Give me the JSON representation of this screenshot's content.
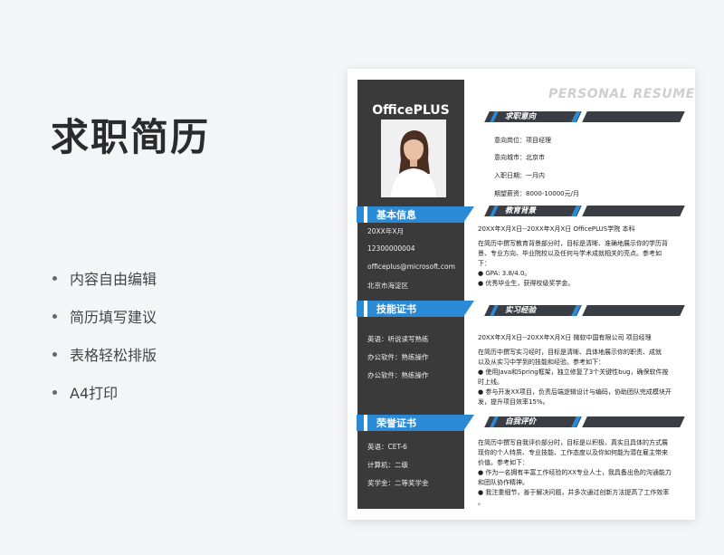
{
  "promo": {
    "title": "求职简历",
    "features": [
      "内容自由编辑",
      "简历填写建议",
      "表格轻松排版",
      "A4打印"
    ]
  },
  "resume": {
    "brand": "OfficePLUS",
    "header": "PERSONAL RESUME",
    "sidebar": {
      "basic": {
        "title": "基本信息",
        "items": [
          "20XX年X月",
          "12300000004",
          "officeplus@microsoft.com",
          "北京市海淀区"
        ]
      },
      "skills": {
        "title": "技能证书",
        "items": [
          "英语：听说读写熟练",
          "办公软件：熟练操作",
          "办公软件：熟练操作"
        ]
      },
      "honors": {
        "title": "荣誉证书",
        "items": [
          "英语：CET-6",
          "计算机：二级",
          "奖学金：二等奖学金"
        ]
      }
    },
    "intent": {
      "title": "求职意向",
      "rows": [
        "意向岗位：项目经理",
        "意向城市：北京市",
        "入职日期：一月内",
        "期望薪资：8000-10000元/月"
      ]
    },
    "education": {
      "title": "教育背景",
      "header": "20XX年X月X日--20XX年X月X日      OfficePLUS学院      本科",
      "lines": [
        "在简历中撰写教育背景部分时，目标是清晰、准确地展示你的学历背",
        "景、专业方向、毕业院校以及任何与学术成就相关的亮点。参考如",
        "下：",
        "● GPA: 3.8/4.0。",
        "● 优秀毕业生，获得校级奖学金。"
      ]
    },
    "internship": {
      "title": "实习经验",
      "header": "20XX年X月X日--20XX年X月X日      微软中国有限公司      项目经理",
      "lines": [
        "在简历中撰写实习经时，目标是清晰、具体地展示你的职责、成就",
        "以及从实习中学到的技能和经验。参考如下：",
        "● 使用Java和Spring框架，独立修复了3个关键性bug，确保软件按",
        "时上线。",
        "● 参与开发XX项目，负责后端逻辑设计与编码，协助团队完成模块开",
        "发，提升项目效率15%。"
      ]
    },
    "self": {
      "title": "自我评价",
      "lines": [
        "在简历中撰写自我评价部分时，目标是以积极、真实且具体的方式展",
        "现你的个人特质、专业技能、工作态度以及你如何能为潜在雇主带来",
        "价值。参考如下：",
        "● 作为一名拥有丰富工作经验的XX专业人士，我具备出色的沟通能力",
        "和团队协作精神。",
        "● 我注重细节，善于解决问题，并多次通过创新方法提高了工作效率",
        "。"
      ]
    }
  }
}
